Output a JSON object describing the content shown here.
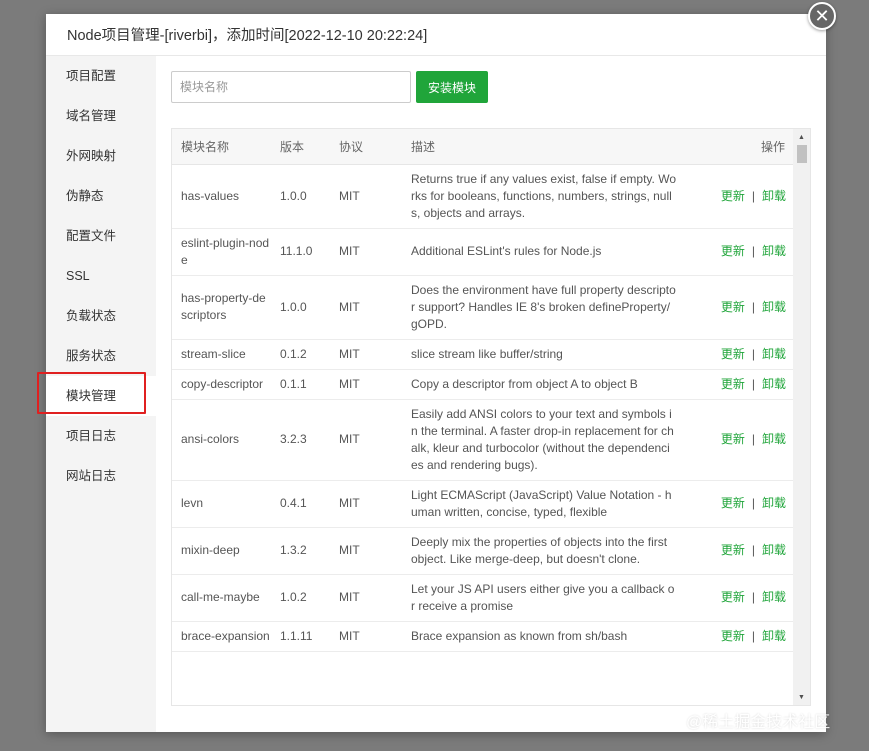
{
  "dialog": {
    "title": "Node项目管理-[riverbi]，添加时间[2022-12-10 20:22:24]",
    "close_glyph": "✕"
  },
  "sidebar": {
    "items": [
      {
        "label": "项目配置"
      },
      {
        "label": "域名管理"
      },
      {
        "label": "外网映射"
      },
      {
        "label": "伪静态"
      },
      {
        "label": "配置文件"
      },
      {
        "label": "SSL"
      },
      {
        "label": "负载状态"
      },
      {
        "label": "服务状态"
      },
      {
        "label": "模块管理",
        "active": true
      },
      {
        "label": "项目日志"
      },
      {
        "label": "网站日志"
      }
    ],
    "highlight_color": "#e02020"
  },
  "toolbar": {
    "search_placeholder": "模块名称",
    "search_value": "",
    "install_label": "安装模块"
  },
  "table": {
    "headers": {
      "name": "模块名称",
      "version": "版本",
      "license": "协议",
      "desc": "描述",
      "ops": "操作"
    },
    "op_update": "更新",
    "op_sep": "|",
    "op_uninstall": "卸载",
    "rows": [
      {
        "name": "has-values",
        "version": "1.0.0",
        "license": "MIT",
        "desc": "Returns true if any values exist, false if empty. Works for booleans, functions, numbers, strings, nulls, objects and arrays."
      },
      {
        "name": "eslint-plugin-node",
        "version": "11.1.0",
        "license": "MIT",
        "desc": "Additional ESLint's rules for Node.js"
      },
      {
        "name": "has-property-descriptors",
        "version": "1.0.0",
        "license": "MIT",
        "desc": "Does the environment have full property descriptor support? Handles IE 8's broken defineProperty/gOPD."
      },
      {
        "name": "stream-slice",
        "version": "0.1.2",
        "license": "MIT",
        "desc": "slice stream like buffer/string"
      },
      {
        "name": "copy-descriptor",
        "version": "0.1.1",
        "license": "MIT",
        "desc": "Copy a descriptor from object A to object B"
      },
      {
        "name": "ansi-colors",
        "version": "3.2.3",
        "license": "MIT",
        "desc": "Easily add ANSI colors to your text and symbols in the terminal. A faster drop-in replacement for chalk, kleur and turbocolor (without the dependencies and rendering bugs)."
      },
      {
        "name": "levn",
        "version": "0.4.1",
        "license": "MIT",
        "desc": "Light ECMAScript (JavaScript) Value Notation - human written, concise, typed, flexible"
      },
      {
        "name": "mixin-deep",
        "version": "1.3.2",
        "license": "MIT",
        "desc": "Deeply mix the properties of objects into the first object. Like merge-deep, but doesn't clone."
      },
      {
        "name": "call-me-maybe",
        "version": "1.0.2",
        "license": "MIT",
        "desc": "Let your JS API users either give you a callback or receive a promise"
      },
      {
        "name": "brace-expansion",
        "version": "1.1.11",
        "license": "MIT",
        "desc": "Brace expansion as known from sh/bash"
      }
    ]
  },
  "scrollbar": {
    "up_glyph": "▲",
    "down_glyph": "▼"
  },
  "watermark": {
    "text": "@稀土掘金技术社区"
  },
  "colors": {
    "accent": "#20a53a",
    "overlay": "#7b7b7b"
  }
}
